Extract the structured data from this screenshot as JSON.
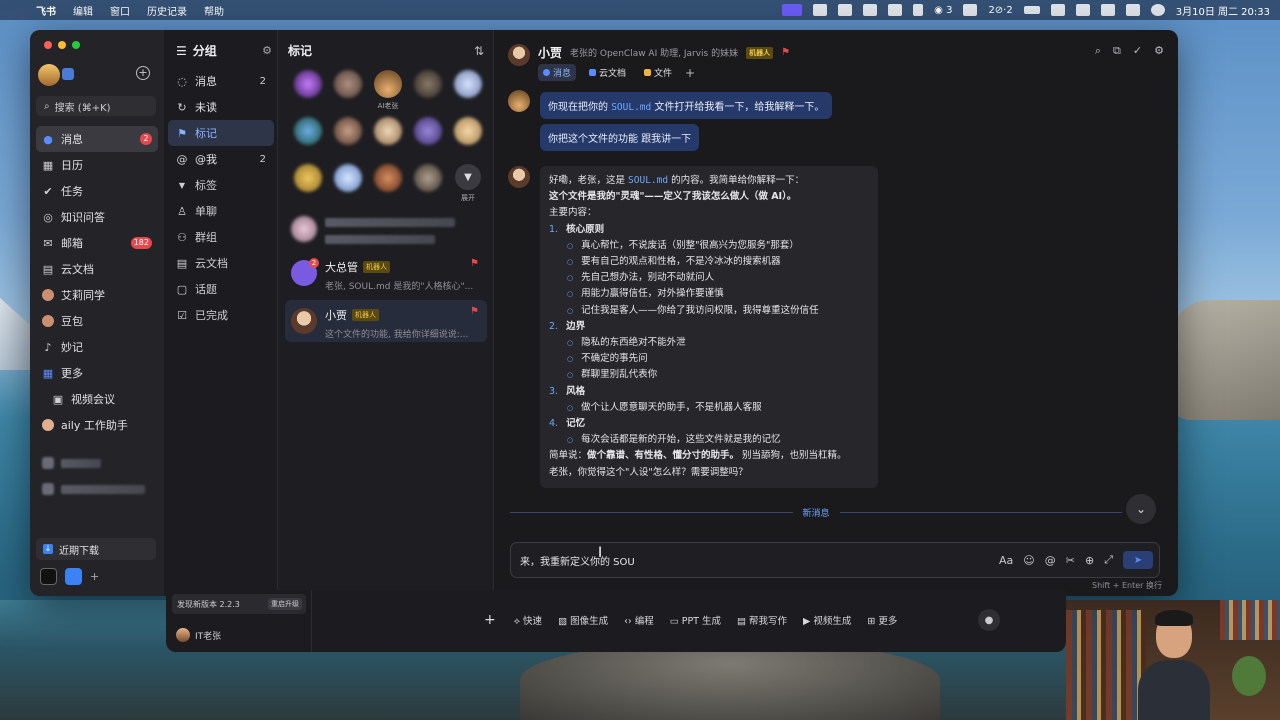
{
  "menubar": {
    "app": "飞书",
    "menus": [
      "编辑",
      "窗口",
      "历史记录",
      "帮助"
    ],
    "wechat_count": "3",
    "net_status": "2⊘·2",
    "datetime": "3月10日 周二  20:33"
  },
  "sidebar": {
    "search_placeholder": "搜索 (⌘+K)",
    "items": [
      {
        "label": "消息",
        "badge": "2",
        "icon": "message-icon"
      },
      {
        "label": "日历",
        "badge": "",
        "icon": "calendar-icon"
      },
      {
        "label": "任务",
        "badge": "",
        "icon": "check-icon"
      },
      {
        "label": "知识问答",
        "badge": "",
        "icon": "knowledge-icon"
      },
      {
        "label": "邮箱",
        "badge": "182",
        "icon": "mail-icon"
      },
      {
        "label": "云文档",
        "badge": "",
        "icon": "docs-icon"
      },
      {
        "label": "艾莉同学",
        "badge": "",
        "icon": "avatar-icon"
      },
      {
        "label": "豆包",
        "badge": "",
        "icon": "avatar-icon"
      },
      {
        "label": "妙记",
        "badge": "",
        "icon": "minutes-icon"
      },
      {
        "label": "更多",
        "badge": "",
        "icon": "grid-icon"
      },
      {
        "label": "视频会议",
        "badge": "",
        "icon": "video-icon"
      },
      {
        "label": "aily 工作助手",
        "badge": "",
        "icon": "avatar-icon"
      }
    ],
    "recent_downloads": "近期下载"
  },
  "groups": {
    "title": "分组",
    "items": [
      {
        "label": "消息",
        "count": "2"
      },
      {
        "label": "未读",
        "count": ""
      },
      {
        "label": "标记",
        "count": ""
      },
      {
        "label": "@我",
        "count": "2"
      },
      {
        "label": "标签",
        "count": ""
      },
      {
        "label": "单聊",
        "count": ""
      },
      {
        "label": "群组",
        "count": ""
      },
      {
        "label": "云文档",
        "count": ""
      },
      {
        "label": "话题",
        "count": ""
      },
      {
        "label": "已完成",
        "count": ""
      }
    ]
  },
  "flagged": {
    "title": "标记",
    "avatar_labels": [
      "",
      "",
      "AI老张",
      "",
      "",
      "",
      "",
      "",
      "",
      "",
      "",
      "",
      "",
      "",
      "展开"
    ],
    "expand_label": "展开",
    "conversations": [
      {
        "name": "大总管",
        "tag": "机器人",
        "preview": "老张, SOUL.md 是我的\"人格核心\"...",
        "badge": "2"
      },
      {
        "name": "小贾",
        "tag": "机器人",
        "preview": "这个文件的功能, 我给你详细说说:..."
      }
    ]
  },
  "chat": {
    "name": "小贾",
    "description": "老张的 OpenClaw AI 助理, Jarvis 的妹妹",
    "tag": "机器人",
    "tabs": [
      "消息",
      "云文档",
      "文件"
    ],
    "user_msg_1_pre": "你现在把你的 ",
    "user_msg_1_code": "SOUL.md",
    "user_msg_1_post": " 文件打开给我看一下，给我解释一下。",
    "user_msg_2": "你把这个文件的功能  跟我讲一下",
    "reply": {
      "intro_pre": "好嘞，老张，这是 ",
      "intro_code": "SOUL.md",
      "intro_post": " 的内容。我简单给你解释一下：",
      "line2": "这个文件是我的\"灵魂\"——定义了我该怎么做人（做 AI）。",
      "line3": "主要内容：",
      "sections": [
        {
          "num": "1.",
          "title": "核心原则",
          "points": [
            "真心帮忙，不说废话（别整\"很高兴为您服务\"那套）",
            "要有自己的观点和性格，不是冷冰冰的搜索机器",
            "先自己想办法，别动不动就问人",
            "用能力赢得信任，对外操作要谨慎",
            "记住我是客人——你给了我访问权限，我得尊重这份信任"
          ]
        },
        {
          "num": "2.",
          "title": "边界",
          "points": [
            "隐私的东西绝对不能外泄",
            "不确定的事先问",
            "群聊里别乱代表你"
          ]
        },
        {
          "num": "3.",
          "title": "风格",
          "points": [
            "做个让人愿意聊天的助手，不是机器人客服"
          ]
        },
        {
          "num": "4.",
          "title": "记忆",
          "points": [
            "每次会话都是新的开始，这些文件就是我的记忆"
          ]
        }
      ],
      "summary_pre": "简单说：",
      "summary_bold": "做个靠谱、有性格、懂分寸的助手。",
      "summary_post": " 别当舔狗，也别当杠精。",
      "closing": "老张，你觉得这个\"人设\"怎么样？需要调整吗？"
    },
    "new_message_divider": "新消息",
    "input_value": "来，我重新定义你的 SOU",
    "input_hint": "Shift + Enter 换行"
  },
  "bottom_window": {
    "update_text": "发现新版本 2.2.3",
    "restart_label": "重启升级",
    "user_name": "IT老张",
    "tools": [
      "快速",
      "图像生成",
      "编程",
      "PPT 生成",
      "帮我写作",
      "视频生成",
      "更多"
    ]
  }
}
